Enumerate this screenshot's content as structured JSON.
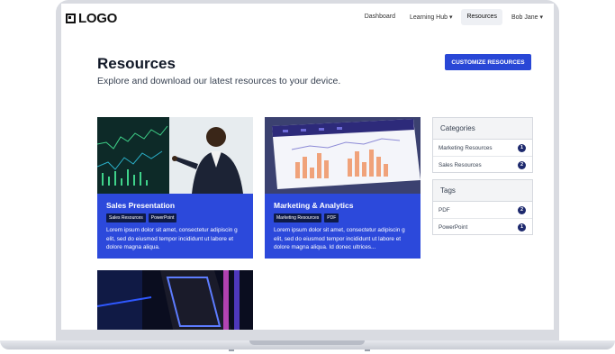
{
  "nav": {
    "logo_text": "LOGO",
    "items": [
      {
        "label": "Dashboard"
      },
      {
        "label": "Learning Hub ▾"
      },
      {
        "label": "Resources"
      },
      {
        "label": "Bob Jane ▾"
      }
    ]
  },
  "header": {
    "title": "Resources",
    "subtitle": "Explore and download our latest resources to your device.",
    "button_label": "CUSTOMIZE RESOURCES"
  },
  "cards": [
    {
      "title": "Sales Presentation",
      "tags": [
        "Sales Resources",
        "PowerPoint"
      ],
      "description": "Lorem ipsum dolor sit amet, consectetur adipiscin g elit, sed do eiusmod tempor incididunt ut labore et dolore magna aliqua."
    },
    {
      "title": "Marketing & Analytics",
      "tags": [
        "Marketing Resources",
        "PDF"
      ],
      "description": "Lorem ipsum dolor sit amet, consectetur adipiscin g elit, sed do eiusmod tempor incididunt ut labore et dolore magna aliqua. Id donec ultrices..."
    },
    {
      "title": "",
      "tags": [],
      "description": ""
    }
  ],
  "sidebar": {
    "categories": {
      "title": "Categories",
      "items": [
        {
          "label": "Marketing Resources",
          "count": "1"
        },
        {
          "label": "Sales Resources",
          "count": "2"
        }
      ]
    },
    "tags": {
      "title": "Tags",
      "items": [
        {
          "label": "PDF",
          "count": "2"
        },
        {
          "label": "PowerPoint",
          "count": "1"
        }
      ]
    }
  },
  "colors": {
    "accent": "#2947d6",
    "card_blue": "#2c49db",
    "tag_bg": "#0e1a47",
    "badge": "#1e2a6e"
  },
  "icons": {
    "logo": "logo-square-icon",
    "dropdown": "chevron-down-icon"
  }
}
